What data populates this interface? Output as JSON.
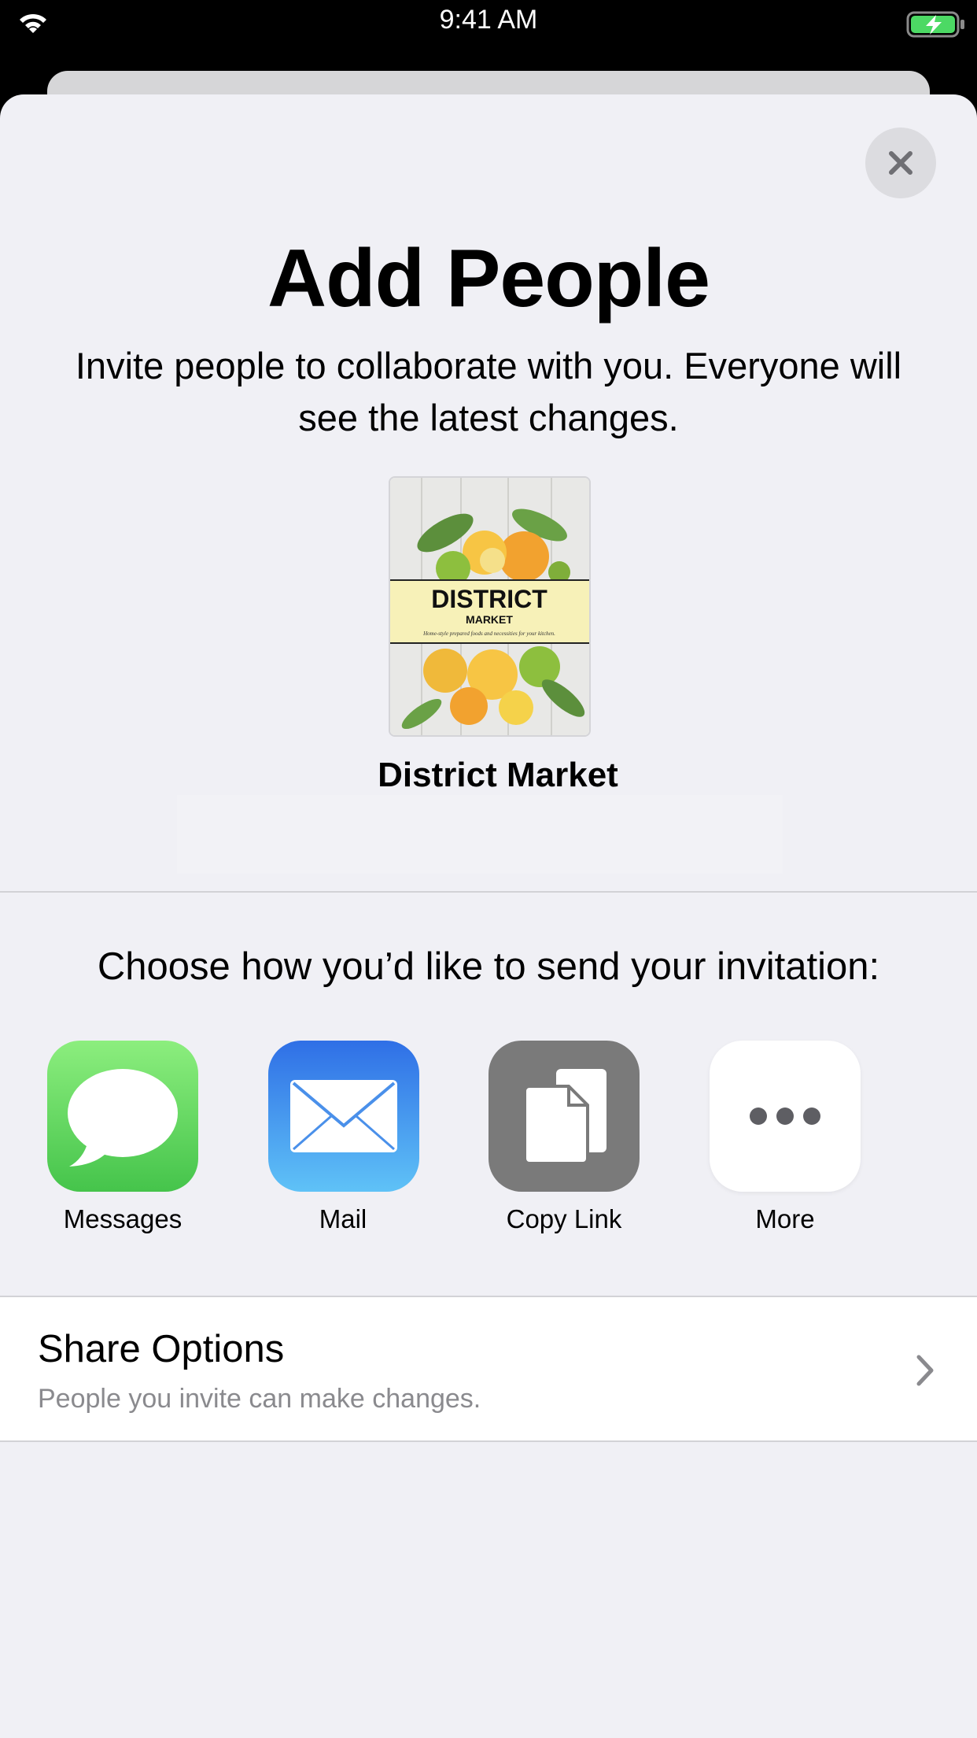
{
  "status_bar": {
    "time": "9:41 AM",
    "wifi_icon": "wifi-icon",
    "battery_icon": "battery-charging-icon"
  },
  "sheet": {
    "close_icon": "close-icon",
    "title": "Add People",
    "subtitle": "Invite people to collaborate with you. Everyone will see the latest changes.",
    "document": {
      "name": "District Market",
      "cover": {
        "title": "DISTRICT",
        "subtitle": "MARKET",
        "tagline": "Home-style prepared foods and necessities for your kitchen."
      }
    },
    "choose_text": "Choose how you’d like to send your invitation:",
    "apps": [
      {
        "label": "Messages",
        "icon": "messages-icon",
        "color": "#4CD964"
      },
      {
        "label": "Mail",
        "icon": "mail-icon",
        "color": "#3478F6"
      },
      {
        "label": "Copy Link",
        "icon": "copy-link-icon",
        "color": "#7A7A7A"
      },
      {
        "label": "More",
        "icon": "more-icon",
        "color": "#FFFFFF"
      }
    ],
    "share_options": {
      "title": "Share Options",
      "subtitle": "People you invite can make changes.",
      "chevron_icon": "chevron-right-icon"
    }
  },
  "colors": {
    "sheet_background": "#F0F0F5",
    "secondary_text": "#8A8A8E",
    "divider": "#D2D2D6"
  }
}
